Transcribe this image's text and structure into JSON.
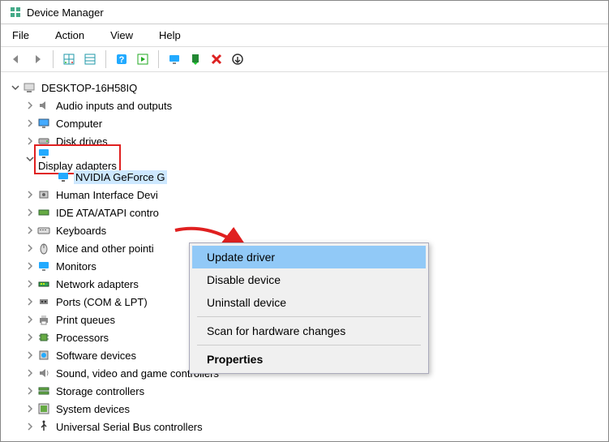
{
  "app_title": "Device Manager",
  "menus": {
    "file": "File",
    "action": "Action",
    "view": "View",
    "help": "Help"
  },
  "toolbar_icons": {
    "back": "back-arrow-icon",
    "forward": "forward-arrow-icon",
    "grid1": "properties-grid-icon",
    "grid2": "table-icon",
    "help": "help-icon",
    "go": "go-icon",
    "monitor": "monitor-icon",
    "install": "install-icon",
    "close": "close-x-icon",
    "refresh": "refresh-icon"
  },
  "root_label": "DESKTOP-16H58IQ",
  "categories": [
    {
      "label": "Audio inputs and outputs",
      "icon": "speaker-icon"
    },
    {
      "label": "Computer",
      "icon": "computer-icon"
    },
    {
      "label": "Disk drives",
      "icon": "disk-icon"
    },
    {
      "label": "Display adapters",
      "icon": "display-adapter-icon",
      "expanded": true,
      "highlighted": true,
      "child": {
        "label": "NVIDIA GeForce G",
        "icon": "display-adapter-icon",
        "selected": true
      }
    },
    {
      "label": "Human Interface Devi",
      "icon": "hid-icon"
    },
    {
      "label": "IDE ATA/ATAPI contro",
      "icon": "ide-icon"
    },
    {
      "label": "Keyboards",
      "icon": "keyboard-icon"
    },
    {
      "label": "Mice and other pointi",
      "icon": "mouse-icon"
    },
    {
      "label": "Monitors",
      "icon": "monitor-icon"
    },
    {
      "label": "Network adapters",
      "icon": "network-icon"
    },
    {
      "label": "Ports (COM & LPT)",
      "icon": "ports-icon"
    },
    {
      "label": "Print queues",
      "icon": "printer-icon"
    },
    {
      "label": "Processors",
      "icon": "cpu-icon"
    },
    {
      "label": "Software devices",
      "icon": "software-icon"
    },
    {
      "label": "Sound, video and game controllers",
      "icon": "sound-icon"
    },
    {
      "label": "Storage controllers",
      "icon": "storage-icon"
    },
    {
      "label": "System devices",
      "icon": "system-icon"
    },
    {
      "label": "Universal Serial Bus controllers",
      "icon": "usb-icon"
    }
  ],
  "context_menu": {
    "update": "Update driver",
    "disable": "Disable device",
    "uninstall": "Uninstall device",
    "scan": "Scan for hardware changes",
    "properties": "Properties"
  },
  "annotation": {
    "arrow_color": "#e02020",
    "box_color": "#e02020"
  }
}
